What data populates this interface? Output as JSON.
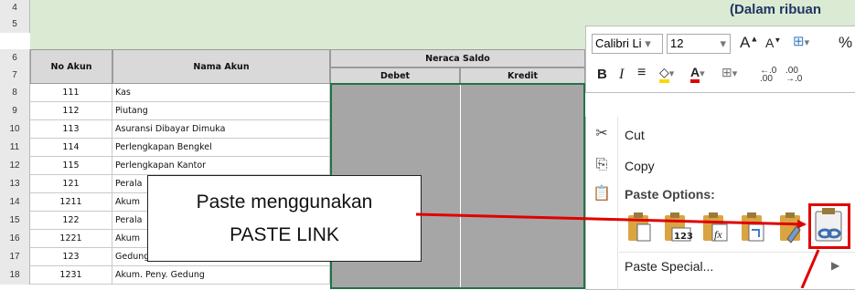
{
  "sheet": {
    "title_fragment": "(Dalam ribuan",
    "row_numbers": [
      "4",
      "5",
      "6",
      "7",
      "8",
      "9",
      "10",
      "11",
      "12",
      "13",
      "14",
      "15",
      "16",
      "17",
      "18"
    ],
    "headers": {
      "no_akun": "No Akun",
      "nama_akun": "Nama Akun",
      "neraca_saldo": "Neraca Saldo",
      "debet": "Debet",
      "kredit": "Kredit"
    },
    "rows": [
      {
        "no": "111",
        "nama": "Kas"
      },
      {
        "no": "112",
        "nama": "Piutang"
      },
      {
        "no": "113",
        "nama": "Asuransi Dibayar Dimuka"
      },
      {
        "no": "114",
        "nama": "Perlengkapan Bengkel"
      },
      {
        "no": "115",
        "nama": "Perlengkapan Kantor"
      },
      {
        "no": "121",
        "nama": "Perala"
      },
      {
        "no": "1211",
        "nama": "Akum"
      },
      {
        "no": "122",
        "nama": "Perala"
      },
      {
        "no": "1221",
        "nama": "Akum"
      },
      {
        "no": "123",
        "nama": "Gedung"
      },
      {
        "no": "1231",
        "nama": "Akum. Peny. Gedung"
      }
    ]
  },
  "callout": {
    "line1": "Paste menggunakan",
    "line2": "PASTE LINK"
  },
  "mini_toolbar": {
    "font_name": "Calibri Li",
    "font_size": "12",
    "bold": "B",
    "italic": "I",
    "percent": "%"
  },
  "context_menu": {
    "cut": "Cut",
    "copy": "Copy",
    "paste_options": "Paste Options:",
    "paste_special": "Paste Special..."
  },
  "colors": {
    "highlight": "#e00000",
    "green_header": "#dbead3",
    "cell_shade": "#a6a6a6",
    "selection_border": "#217346"
  }
}
